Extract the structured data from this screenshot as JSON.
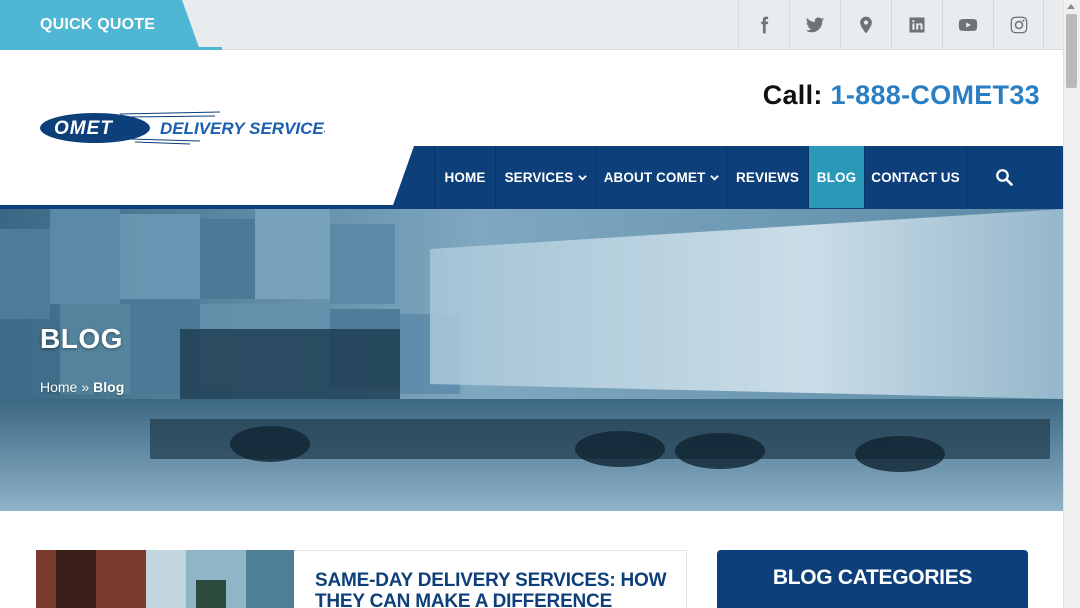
{
  "topbar": {
    "quick_quote": "QUICK QUOTE",
    "socials": [
      {
        "name": "facebook-icon"
      },
      {
        "name": "twitter-icon"
      },
      {
        "name": "map-pin-icon"
      },
      {
        "name": "linkedin-icon"
      },
      {
        "name": "youtube-icon"
      },
      {
        "name": "instagram-icon"
      }
    ]
  },
  "header": {
    "logo_text": "OMET",
    "logo_sub": "DELIVERY SERVICES",
    "call_label": "Call:",
    "phone": "1-888-COMET33"
  },
  "nav": {
    "items": [
      {
        "label": "HOME"
      },
      {
        "label": "SERVICES"
      },
      {
        "label": "ABOUT COMET"
      },
      {
        "label": "REVIEWS"
      },
      {
        "label": "BLOG"
      },
      {
        "label": "CONTACT US"
      }
    ],
    "active": "BLOG",
    "search_icon": "search-icon"
  },
  "hero": {
    "title": "BLOG",
    "breadcrumb_home": "Home",
    "breadcrumb_sep": "»",
    "breadcrumb_current": "Blog"
  },
  "post": {
    "title": "SAME-DAY DELIVERY SERVICES: HOW THEY CAN MAKE A DIFFERENCE"
  },
  "sidebar": {
    "categories_title": "BLOG CATEGORIES"
  },
  "colors": {
    "navy": "#0d3f7a",
    "accent_blue": "#4fb6d3",
    "phone_blue": "#2a7ec4",
    "active_tab": "#2a98b8"
  }
}
